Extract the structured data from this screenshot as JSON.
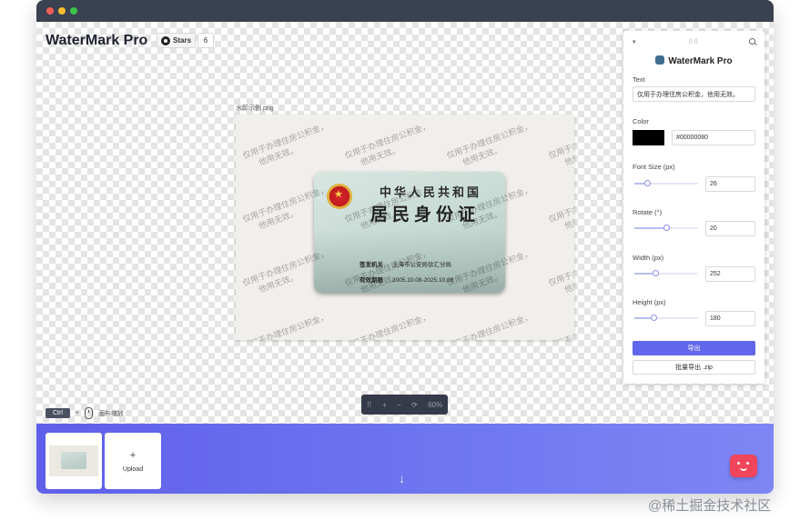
{
  "app": {
    "name": "WaterMark Pro",
    "stars_label": "Stars",
    "stars_count": "6"
  },
  "canvas": {
    "filename": "水印示例.png",
    "card": {
      "title_line1": "中华人民共和国",
      "title_line2": "居民身份证",
      "issuer_key": "签发机关",
      "issuer_value": "上海市公安局徐汇分局",
      "valid_key": "有效期限",
      "valid_value": "2005.10.08-2025.10.08"
    },
    "watermark_line1": "仅用于办理住房公积金，",
    "watermark_line2": "他用无效。",
    "hint": {
      "key": "Ctrl",
      "plus": "+",
      "text": "画布缩放"
    },
    "zoom": {
      "move": "⠿",
      "zoom_in": "+",
      "zoom_out": "−",
      "reset": "⟳",
      "level": "60%"
    }
  },
  "panel": {
    "title": "WaterMark Pro",
    "text_label": "Text",
    "text_value": "仅用于办理住房公积金，他用无效。",
    "color_label": "Color",
    "color_value": "#00000080",
    "font_size_label": "Font Size (px)",
    "font_size_value": "26",
    "font_size_fraction": 0.2,
    "rotate_label": "Rotate (°)",
    "rotate_value": "20",
    "rotate_fraction": 0.5,
    "width_label": "Width (px)",
    "width_value": "252",
    "width_fraction": 0.33,
    "height_label": "Height (px)",
    "height_value": "180",
    "height_fraction": 0.3,
    "export_label": "导出",
    "batch_export_label": "批量导出 .zip"
  },
  "bottom": {
    "upload_plus": "+",
    "upload_label": "Upload",
    "down_arrow": "↓"
  },
  "credit": "@稀土掘金技术社区",
  "colors": {
    "accent": "#6166ea",
    "titlebar": "#3a4150",
    "swatch": "#000000"
  }
}
